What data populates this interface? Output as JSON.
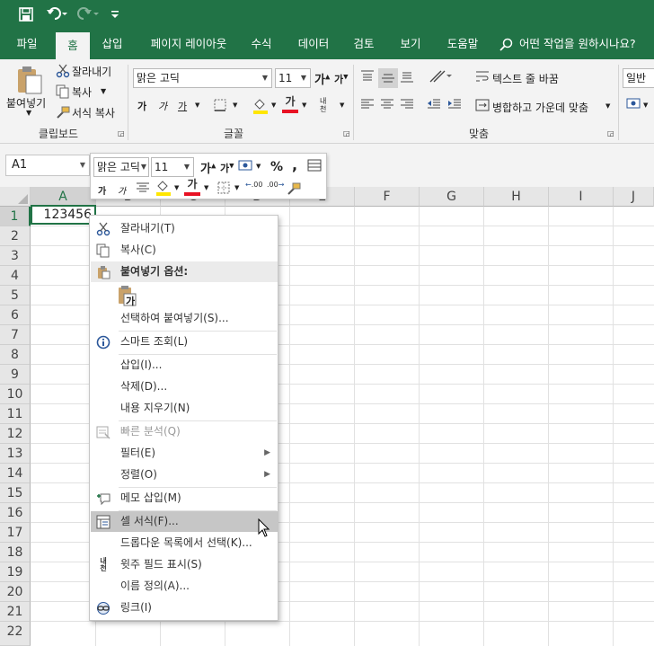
{
  "titlebar": {
    "save_icon": "save-icon",
    "undo_icon": "undo-icon",
    "redo_icon": "redo-icon",
    "customize_icon": "customize-icon"
  },
  "tabs": [
    {
      "label": "파일",
      "active": false
    },
    {
      "label": "홈",
      "active": true
    },
    {
      "label": "삽입",
      "active": false
    },
    {
      "label": "페이지 레이아웃",
      "active": false
    },
    {
      "label": "수식",
      "active": false
    },
    {
      "label": "데이터",
      "active": false
    },
    {
      "label": "검토",
      "active": false
    },
    {
      "label": "보기",
      "active": false
    },
    {
      "label": "도움말",
      "active": false
    }
  ],
  "tellme": "어떤 작업을 원하시나요?",
  "ribbon": {
    "paste": "붙여넣기",
    "cut": "잘라내기",
    "copy": "복사",
    "format_painter": "서식 복사",
    "clipboard_label": "클립보드",
    "font_label": "글꼴",
    "align_label": "맞춤",
    "font_name": "맑은 고딕",
    "font_size": "11",
    "bold": "가",
    "italic": "가",
    "underline": "가",
    "grow": "가",
    "shrink": "가",
    "font_color_glyph": "가",
    "phonetic": "내천",
    "wrap": "텍스트 줄 바꿈",
    "merge": "병합하고 가운데 맞춤",
    "number_format": "일반"
  },
  "namebox": "A1",
  "minibar": {
    "font_name": "맑은 고딕",
    "font_size": "11",
    "bold": "가",
    "italic": "가",
    "font_color_glyph": "가",
    "percent": "%",
    "comma": ",",
    "dec_inc": ".00",
    "dec_dec": ".00"
  },
  "columns": [
    "A",
    "B",
    "C",
    "D",
    "E",
    "F",
    "G",
    "H",
    "I",
    "J"
  ],
  "rows": [
    "1",
    "2",
    "3",
    "4",
    "5",
    "6",
    "7",
    "8",
    "9",
    "10",
    "11",
    "12",
    "13",
    "14",
    "15",
    "16",
    "17",
    "18",
    "19",
    "20",
    "21",
    "22"
  ],
  "cells": {
    "A1": "123456"
  },
  "menu": [
    {
      "label": "잘라내기(T)",
      "icon": "scissors-icon"
    },
    {
      "label": "복사(C)",
      "icon": "copy-icon"
    },
    {
      "label": "붙여넣기 옵션:",
      "icon": "clipboard-icon",
      "header": true
    },
    {
      "label": "가",
      "icon": "",
      "paste_option": true
    },
    {
      "label": "선택하여 붙여넣기(S)...",
      "icon": ""
    },
    {
      "label": "스마트 조회(L)",
      "icon": "smart-lookup-icon"
    },
    {
      "label": "삽입(I)...",
      "icon": ""
    },
    {
      "label": "삭제(D)...",
      "icon": ""
    },
    {
      "label": "내용 지우기(N)",
      "icon": ""
    },
    {
      "label": "빠른 분석(Q)",
      "icon": "quick-analysis-icon",
      "disabled": true
    },
    {
      "label": "필터(E)",
      "icon": "",
      "submenu": true
    },
    {
      "label": "정렬(O)",
      "icon": "",
      "submenu": true
    },
    {
      "label": "메모 삽입(M)",
      "icon": "comment-icon"
    },
    {
      "label": "셀 서식(F)...",
      "icon": "format-cells-icon",
      "highlight": true
    },
    {
      "label": "드롭다운 목록에서 선택(K)...",
      "icon": ""
    },
    {
      "label": "윗주 필드 표시(S)",
      "icon": "phonetic-icon"
    },
    {
      "label": "이름 정의(A)...",
      "icon": ""
    },
    {
      "label": "링크(I)",
      "icon": "link-icon"
    }
  ],
  "colors": {
    "brand": "#217346",
    "font_color_bar": "#e81123",
    "highlight_bar": "#ffe600"
  }
}
